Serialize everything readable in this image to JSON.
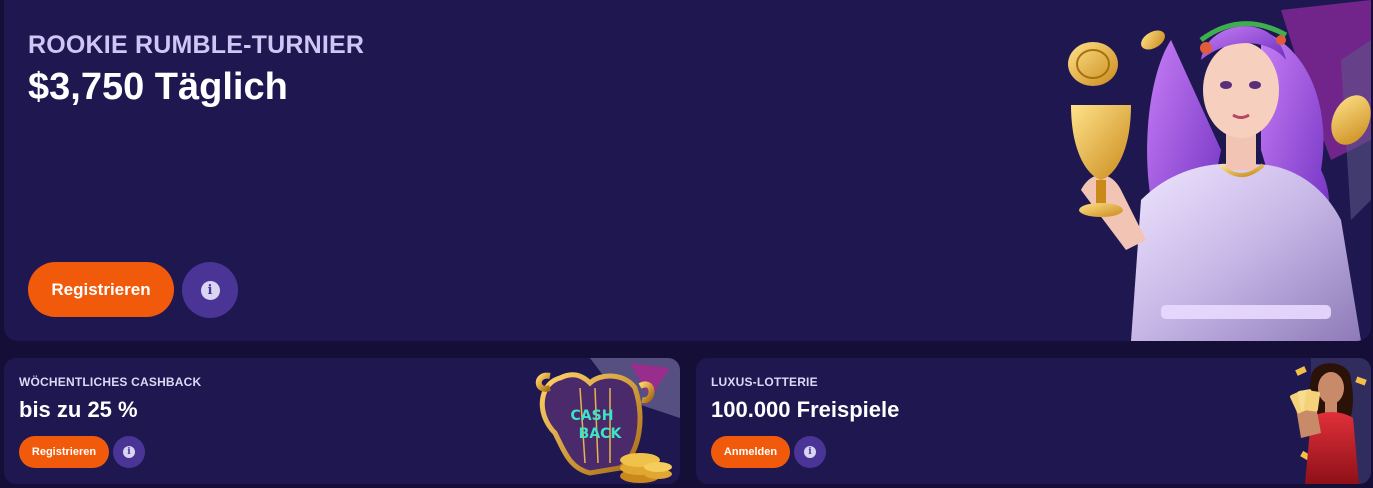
{
  "hero": {
    "eyebrow": "ROOKIE RUMBLE-TURNIER",
    "title": "$3,750 Täglich",
    "primary_button": "Registrieren",
    "info_icon": "info-icon"
  },
  "cards": [
    {
      "eyebrow": "WÖCHENTLICHES CASHBACK",
      "title": "bis zu 25 %",
      "primary_button": "Registrieren",
      "info_icon": "info-icon",
      "art_text": [
        "CASH",
        "BACK"
      ]
    },
    {
      "eyebrow": "LUXUS-LOTTERIE",
      "title": "100.000 Freispiele",
      "primary_button": "Anmelden",
      "info_icon": "info-icon"
    }
  ],
  "colors": {
    "page_background": "#150f38",
    "card_background": "#1f1850",
    "primary_button": "#f25a0b",
    "info_button": "#4a3597",
    "eyebrow_text": "#cfc6f6"
  }
}
